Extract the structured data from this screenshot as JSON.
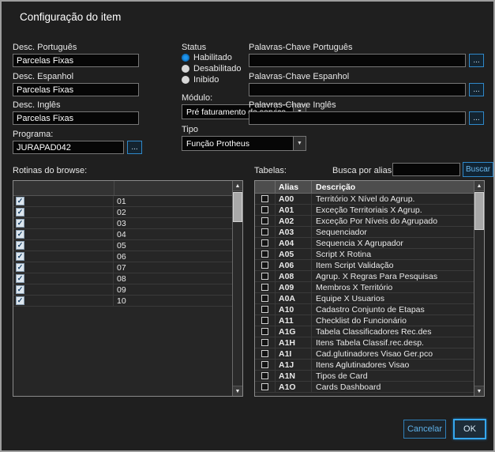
{
  "window": {
    "title": "Configuração do item"
  },
  "fields": {
    "desc_pt": {
      "label": "Desc. Português",
      "value": "Parcelas Fixas"
    },
    "desc_es": {
      "label": "Desc. Espanhol",
      "value": "Parcelas Fixas"
    },
    "desc_en": {
      "label": "Desc. Inglês",
      "value": "Parcelas Fixas"
    },
    "programa": {
      "label": "Programa:",
      "value": "JURAPAD042"
    }
  },
  "status": {
    "label": "Status",
    "options": [
      {
        "label": "Habilitado",
        "selected": true
      },
      {
        "label": "Desabilitado",
        "selected": false
      },
      {
        "label": "Inibido",
        "selected": false
      }
    ]
  },
  "modulo": {
    "label": "Módulo:",
    "value": "Pré faturamento de serviço"
  },
  "tipo": {
    "label": "Tipo",
    "value": "Função Protheus"
  },
  "keywords": {
    "pt": {
      "label": "Palavras-Chave Português",
      "value": ""
    },
    "es": {
      "label": "Palavras-Chave Espanhol",
      "value": ""
    },
    "en": {
      "label": "Palavras-Chave Inglês",
      "value": ""
    }
  },
  "routines": {
    "label": "Rotinas do browse:",
    "items": [
      "01",
      "02",
      "03",
      "04",
      "05",
      "06",
      "07",
      "08",
      "09",
      "10"
    ]
  },
  "tables": {
    "label": "Tabelas:",
    "search_label": "Busca por alias:",
    "search_value": "",
    "button_label": "Buscar",
    "columns": [
      "Alias",
      "Descrição"
    ],
    "rows": [
      {
        "alias": "A00",
        "desc": "Território X Nível do Agrup."
      },
      {
        "alias": "A01",
        "desc": "Exceção Territoriais X Agrup."
      },
      {
        "alias": "A02",
        "desc": "Exceção Por Níveis do Agrupado"
      },
      {
        "alias": "A03",
        "desc": "Sequenciador"
      },
      {
        "alias": "A04",
        "desc": "Sequencia X Agrupador"
      },
      {
        "alias": "A05",
        "desc": "Script X Rotina"
      },
      {
        "alias": "A06",
        "desc": "Item Script Validação"
      },
      {
        "alias": "A08",
        "desc": "Agrup. X Regras Para Pesquisas"
      },
      {
        "alias": "A09",
        "desc": "Membros X Território"
      },
      {
        "alias": "A0A",
        "desc": "Equipe X Usuarios"
      },
      {
        "alias": "A10",
        "desc": "Cadastro Conjunto de Etapas"
      },
      {
        "alias": "A11",
        "desc": "Checklist do Funcionário"
      },
      {
        "alias": "A1G",
        "desc": "Tabela Classificadores Rec.des"
      },
      {
        "alias": "A1H",
        "desc": "Itens Tabela Classif.rec.desp."
      },
      {
        "alias": "A1I",
        "desc": "Cad.glutinadores Visao Ger.pco"
      },
      {
        "alias": "A1J",
        "desc": "Itens Aglutinadores Visao"
      },
      {
        "alias": "A1N",
        "desc": "Tipos de Card"
      },
      {
        "alias": "A1O",
        "desc": "Cards Dashboard"
      }
    ]
  },
  "footer": {
    "cancel_label": "Cancelar",
    "ok_label": "OK"
  },
  "icons": {
    "ellipsis": "...",
    "dropdown": "▼",
    "scroll_up": "▲",
    "scroll_down": "▼",
    "check": "✓"
  },
  "colors": {
    "accent": "#2f9be8",
    "window_bg": "#1f1f1f",
    "input_bg": "#060606"
  }
}
